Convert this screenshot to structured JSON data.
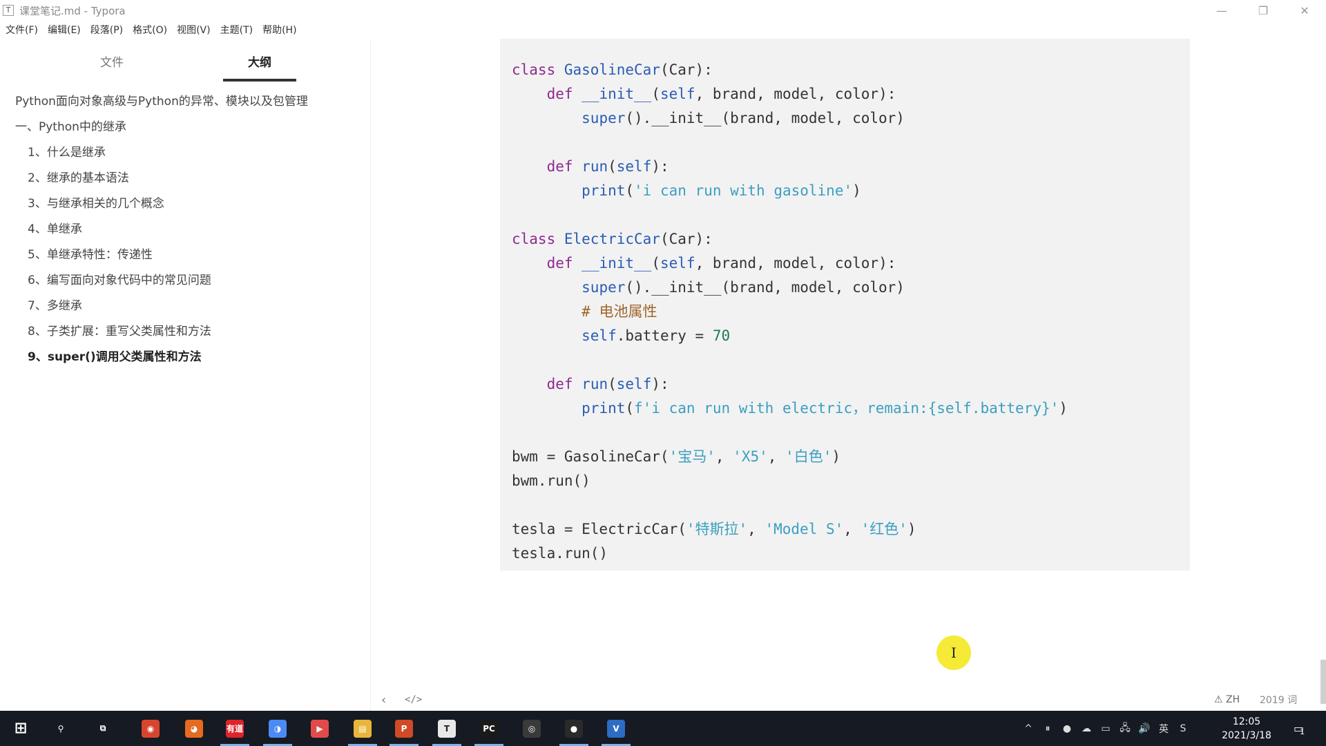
{
  "window": {
    "title": "课堂笔记.md - Typora",
    "app_icon": "T",
    "controls": {
      "minimize": "—",
      "maximize": "❐",
      "close": "✕"
    }
  },
  "menu": [
    "文件(F)",
    "编辑(E)",
    "段落(P)",
    "格式(O)",
    "视图(V)",
    "主题(T)",
    "帮助(H)"
  ],
  "sidebar": {
    "tabs": {
      "files": "文件",
      "outline": "大纲"
    },
    "active_tab": "outline",
    "outline": [
      {
        "label": "Python面向对象高级与Python的异常、模块以及包管理",
        "level": 1
      },
      {
        "label": "一、Python中的继承",
        "level": 2
      },
      {
        "label": "1、什么是继承",
        "level": 3
      },
      {
        "label": "2、继承的基本语法",
        "level": 3
      },
      {
        "label": "3、与继承相关的几个概念",
        "level": 3
      },
      {
        "label": "4、单继承",
        "level": 3
      },
      {
        "label": "5、单继承特性：传递性",
        "level": 3
      },
      {
        "label": "6、编写面向对象代码中的常见问题",
        "level": 3
      },
      {
        "label": "7、多继承",
        "level": 3
      },
      {
        "label": "8、子类扩展：重写父类属性和方法",
        "level": 3
      },
      {
        "label": "9、super()调用父类属性和方法",
        "level": 3,
        "active": true
      }
    ]
  },
  "code": {
    "language": "python",
    "lines": [
      "class GasolineCar(Car):",
      "    def __init__(self, brand, model, color):",
      "        super().__init__(brand, model, color)",
      "",
      "    def run(self):",
      "        print('i can run with gasoline')",
      "",
      "class ElectricCar(Car):",
      "    def __init__(self, brand, model, color):",
      "        super().__init__(brand, model, color)",
      "        # 电池属性",
      "        self.battery = 70",
      "",
      "    def run(self):",
      "        print(f'i can run with electric，remain:{self.battery}')",
      "",
      "bwm = GasolineCar('宝马', 'X5', '白色')",
      "bwm.run()",
      "",
      "tesla = ElectricCar('特斯拉', 'Model S', '红色')",
      "tesla.run()"
    ]
  },
  "cursor_glyph": "I",
  "statusbar": {
    "back_icon": "‹",
    "source_icon": "</>",
    "language": "⚠ ZH",
    "word_count": "2019 词"
  },
  "taskbar": {
    "apps": [
      {
        "name": "start",
        "glyph": "⊞",
        "color": "#161a22"
      },
      {
        "name": "search",
        "glyph": "⚲",
        "color": "#161a22"
      },
      {
        "name": "task-view",
        "glyph": "⧉",
        "color": "#161a22"
      },
      {
        "name": "chrome",
        "glyph": "◉",
        "color": "#d8452f"
      },
      {
        "name": "firefox",
        "glyph": "◕",
        "color": "#e66a1f"
      },
      {
        "name": "youdao",
        "glyph": "有道",
        "color": "#e0222a"
      },
      {
        "name": "browser",
        "glyph": "◑",
        "color": "#4c8bf5"
      },
      {
        "name": "video-app",
        "glyph": "▶",
        "color": "#e34a4a"
      },
      {
        "name": "file-explorer",
        "glyph": "▤",
        "color": "#e8b63a"
      },
      {
        "name": "powerpoint",
        "glyph": "P",
        "color": "#d04a28"
      },
      {
        "name": "typora",
        "glyph": "T",
        "color": "#e8e8e8"
      },
      {
        "name": "pycharm",
        "glyph": "PC",
        "color": "#1a1a1a"
      },
      {
        "name": "obs",
        "glyph": "◎",
        "color": "#3a3a3a"
      },
      {
        "name": "recorder",
        "glyph": "●",
        "color": "#2a2a2a"
      },
      {
        "name": "vnc",
        "glyph": "V",
        "color": "#2c6cc4"
      }
    ],
    "tray": [
      "^",
      "⏸",
      "●",
      "☁",
      "▭",
      "🖧",
      "🔊",
      "英",
      "S"
    ],
    "clock": {
      "time": "12:05",
      "date": "2021/3/18"
    },
    "notification_count": "1"
  }
}
